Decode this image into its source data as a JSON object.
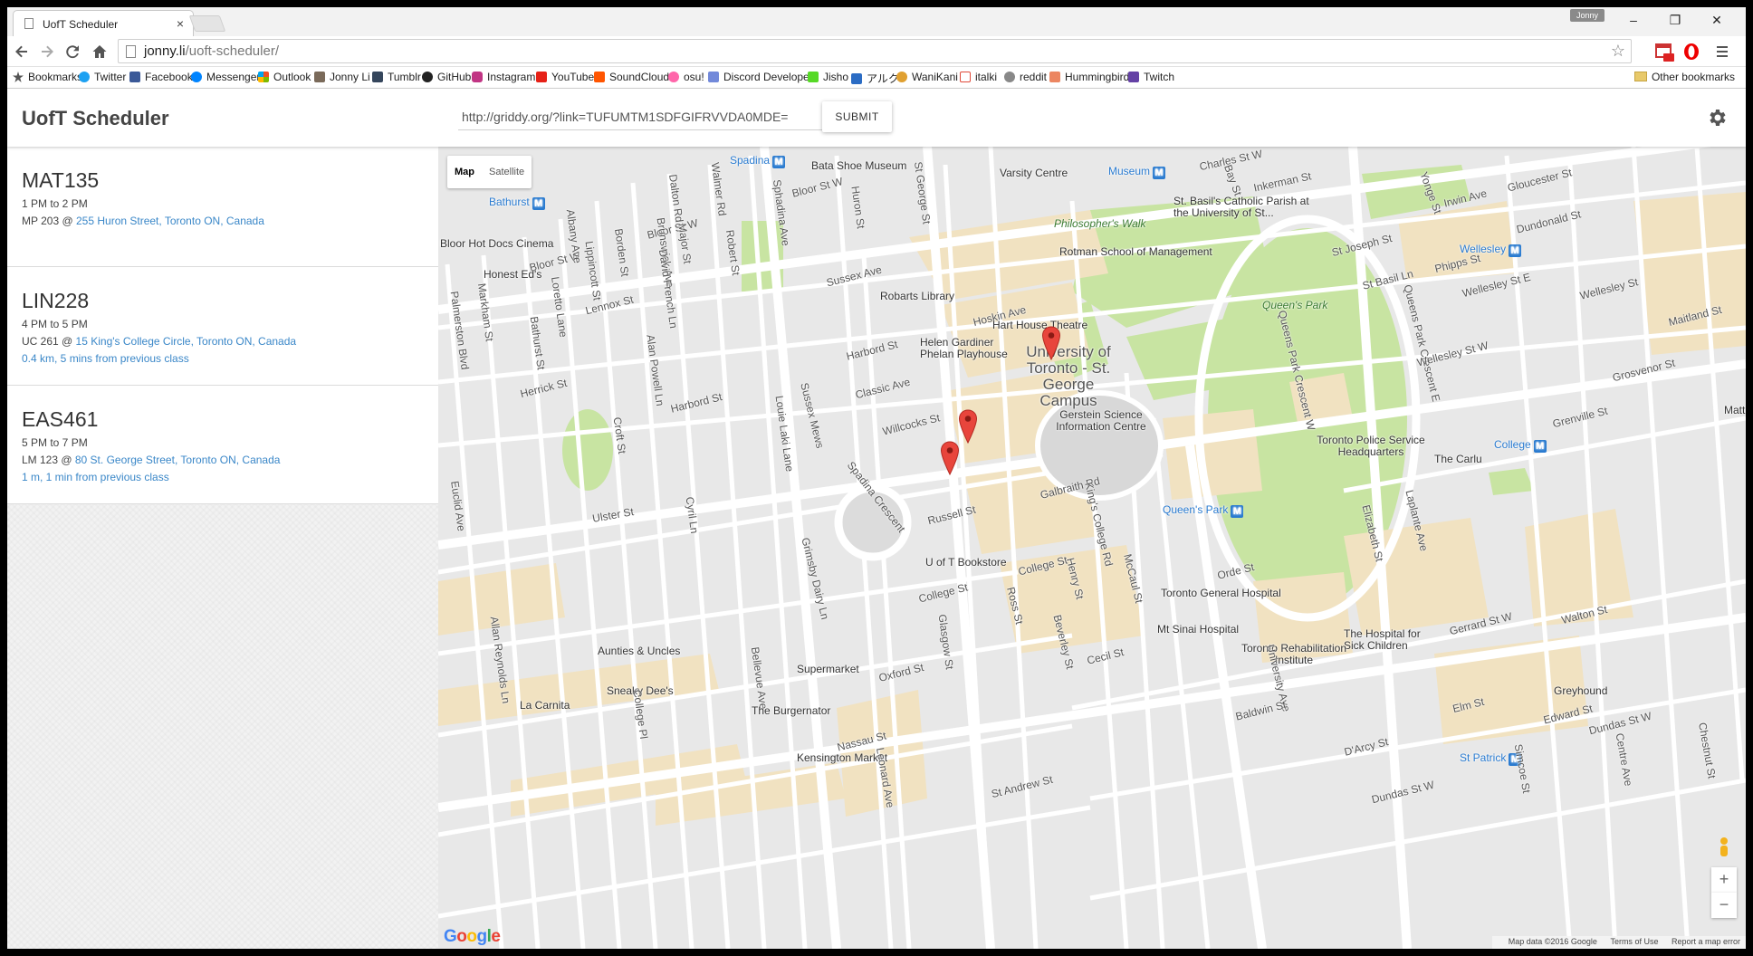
{
  "browser": {
    "tab_title": "UofT Scheduler",
    "tab_close": "×",
    "user_badge": "Jonny",
    "win_minimize": "–",
    "win_restore": "❐",
    "win_close": "✕",
    "url_host": "jonny.li",
    "url_path": "/uoft-scheduler/",
    "bookmarks": [
      {
        "label": "Bookmarks",
        "icon": "star-icon",
        "color": "#555555"
      },
      {
        "label": "Twitter",
        "icon": "twitter-icon",
        "color": "#1da1f2"
      },
      {
        "label": "Facebook",
        "icon": "facebook-icon",
        "color": "#3b5998"
      },
      {
        "label": "Messenger",
        "icon": "messenger-icon",
        "color": "#0084ff"
      },
      {
        "label": "Outlook",
        "icon": "outlook-icon",
        "color": "#f25022"
      },
      {
        "label": "Jonny Li",
        "icon": "avatar-icon",
        "color": "#7a6a5a"
      },
      {
        "label": "Tumblr",
        "icon": "tumblr-icon",
        "color": "#35465c"
      },
      {
        "label": "GitHub",
        "icon": "github-icon",
        "color": "#222222"
      },
      {
        "label": "Instagram",
        "icon": "instagram-icon",
        "color": "#c13584"
      },
      {
        "label": "YouTube",
        "icon": "youtube-icon",
        "color": "#e62117"
      },
      {
        "label": "SoundCloud",
        "icon": "soundcloud-icon",
        "color": "#ff5500"
      },
      {
        "label": "osu!",
        "icon": "osu-icon",
        "color": "#ff66aa"
      },
      {
        "label": "Discord Developers",
        "icon": "discord-icon",
        "color": "#7289da"
      },
      {
        "label": "Jisho",
        "icon": "jisho-icon",
        "color": "#56d926"
      },
      {
        "label": "アルク",
        "icon": "alc-icon",
        "color": "#2b6cc4"
      },
      {
        "label": "WaniKani",
        "icon": "wanikani-icon",
        "color": "#e0a030"
      },
      {
        "label": "italki",
        "icon": "italki-icon",
        "color": "#e04a3a"
      },
      {
        "label": "reddit",
        "icon": "reddit-icon",
        "color": "#888888"
      },
      {
        "label": "Hummingbird",
        "icon": "hummingbird-icon",
        "color": "#ec8661"
      },
      {
        "label": "Twitch",
        "icon": "twitch-icon",
        "color": "#6441a5"
      }
    ],
    "other_bookmarks": "Other bookmarks"
  },
  "app": {
    "title": "UofT Scheduler",
    "link_value": "http://griddy.org/?link=TUFUMTM1SDFGIFRVVDA0MDE=",
    "submit_label": "SUBMIT"
  },
  "classes": [
    {
      "code": "MAT135",
      "time": "1 PM to 2 PM",
      "room": "MP 203 @ ",
      "address": "255 Huron Street, Toronto ON, Canada",
      "distance": ""
    },
    {
      "code": "LIN228",
      "time": "4 PM to 5 PM",
      "room": "UC 261 @ ",
      "address": "15 King's College Circle, Toronto ON, Canada",
      "distance": "0.4 km, 5 mins from previous class"
    },
    {
      "code": "EAS461",
      "time": "5 PM to 7 PM",
      "room": "LM 123 @ ",
      "address": "80 St. George Street, Toronto ON, Canada",
      "distance": "1 m, 1 min from previous class"
    }
  ],
  "map": {
    "type_map": "Map",
    "type_satellite": "Satellite",
    "zoom_in": "+",
    "zoom_out": "−",
    "google": "Google",
    "attribution": [
      "Map data ©2016 Google",
      "Terms of Use",
      "Report a map error"
    ],
    "colors": {
      "park": "#c8e4a2",
      "building": "#f1e2c1",
      "road": "#ffffff",
      "base": "#e8e8e8",
      "pin": "#e8453c",
      "transit": "#2a7bd0"
    },
    "places": [
      "Bata Shoe Museum",
      "Varsity Centre",
      "Museum",
      "Charles St W",
      "Bay St",
      "Inkerman St",
      "Yonge St",
      "Gloucester St",
      "Irwin Ave",
      "Spadina",
      "Bathurst",
      "Bloor St W",
      "Dalton Rd",
      "Walmer Rd",
      "Huron St",
      "St George St",
      "Sphadina Ave",
      "Robert St",
      "Major St",
      "Brunswick Ave",
      "Borden St",
      "Albany Ave",
      "Lippincott St",
      "Bloor Hot Docs Cinema",
      "Honest Ed's",
      "Markham St",
      "Palmerston Blvd",
      "Lennox St",
      "David French Ln",
      "Loretto Lane",
      "Bathurst St",
      "Sussex Ave",
      "Robarts Library",
      "Rotman School of Management",
      "Philosopher's Walk",
      "St. Basil's Catholic Parish at the University of St...",
      "St Joseph St",
      "Wellesley",
      "Dundonald St",
      "Wellesley St",
      "Hoskin Ave",
      "Queen's Park",
      "Phipps St",
      "St Basil Ln",
      "Wellesley St E",
      "Queens Park Crescent E",
      "Queens Park Crescent W",
      "Hart House Theatre",
      "University of Toronto - St. George Campus",
      "Helen Gardiner Phelan Playhouse",
      "Harbord St",
      "Classic Ave",
      "Wellesley St W",
      "Maitland St",
      "Grosvenor St",
      "Gerstein Science Information Centre",
      "Alan Powell Ln",
      "Herrick St",
      "Sussex Mews",
      "Willcocks St",
      "Toronto Police Service Headquarters",
      "College",
      "The Carlu",
      "Grenville St",
      "Matt",
      "Louie Laki Lane",
      "Croft St",
      "Galbraith Rd",
      "King's College Rd",
      "Russell St",
      "Ulster St",
      "Spadina Crescent",
      "Queen's Park",
      "Elizabeth St",
      "Laplante Ave",
      "Euclid Ave",
      "U of T Bookstore",
      "College St",
      "Cyril Ln",
      "Henry St",
      "McCaul St",
      "Orde St",
      "Toronto General Hospital",
      "Grimsby Dairy Ln",
      "Walton St",
      "Gerrard St W",
      "Ross St",
      "Beverley St",
      "Mt Sinai Hospital",
      "The Hospital for Sick Children",
      "Toronto Rehabilitation Institute",
      "Glasgow St",
      "Cecil St",
      "University Ave",
      "Allan Reynolds Ln",
      "Aunties & Uncles",
      "Supermarket",
      "Oxford St",
      "Elm St",
      "Greyhound",
      "Sneaky Dee's",
      "Bellevue Ave",
      "Edward St",
      "La Carnita",
      "College Pl",
      "The Burgernator",
      "Baldwin St",
      "Nassau St",
      "D'Arcy St",
      "St Patrick",
      "Dundas St W",
      "Chestnut St",
      "Kensington Market",
      "St Andrew St",
      "Simcoe St",
      "Centre Ave",
      "Leonard Ave"
    ]
  }
}
